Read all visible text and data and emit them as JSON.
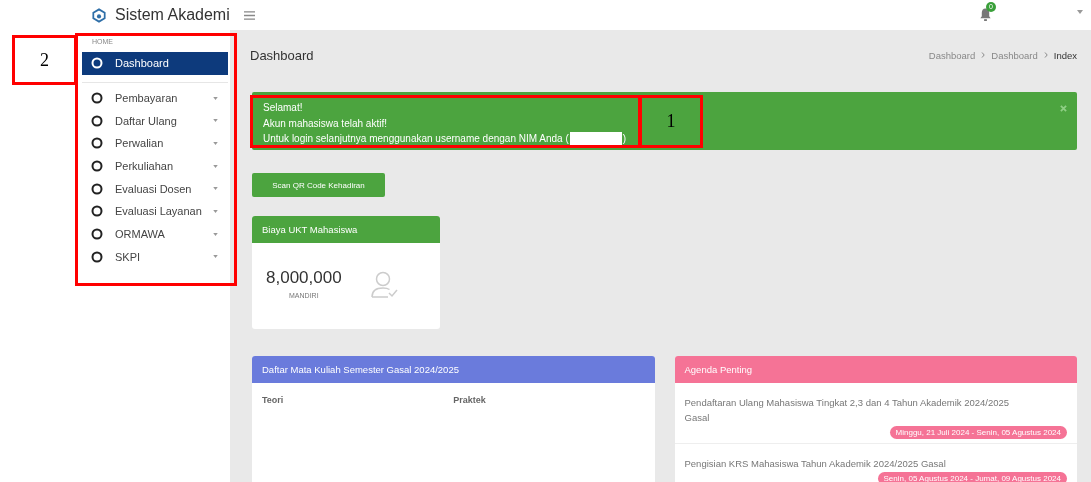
{
  "header": {
    "app_name": "Sistem Akademi",
    "notification_count": "0"
  },
  "sidebar": {
    "section": "HOME",
    "items": [
      {
        "label": "Dashboard",
        "selected": true,
        "has_submenu": false
      },
      {
        "label": "Pembayaran",
        "selected": false,
        "has_submenu": true
      },
      {
        "label": "Daftar Ulang",
        "selected": false,
        "has_submenu": true
      },
      {
        "label": "Perwalian",
        "selected": false,
        "has_submenu": true
      },
      {
        "label": "Perkuliahan",
        "selected": false,
        "has_submenu": true
      },
      {
        "label": "Evaluasi Dosen",
        "selected": false,
        "has_submenu": true
      },
      {
        "label": "Evaluasi Layanan",
        "selected": false,
        "has_submenu": true
      },
      {
        "label": "ORMAWA",
        "selected": false,
        "has_submenu": true
      },
      {
        "label": "SKPI",
        "selected": false,
        "has_submenu": true
      }
    ]
  },
  "page_title": "Dashboard",
  "breadcrumbs": [
    {
      "label": "Dashboard",
      "selected": false
    },
    {
      "label": "Dashboard",
      "selected": false
    },
    {
      "label": "Index",
      "selected": true
    }
  ],
  "alert": {
    "lines": [
      "Selamat!",
      "Akun mahasiswa telah aktif!",
      "Untuk login selanjutnya menggunakan username dengan NIM Anda ("
    ],
    "closing": ")",
    "nim_redacted": true
  },
  "scan_button": "Scan QR Code Kehadiran",
  "ukt_card": {
    "title": "Biaya UKT Mahasiswa",
    "amount": "8,000,000",
    "category": "MANDIRI"
  },
  "courses_card": {
    "title": "Daftar Mata Kuliah Semester Gasal 2024/2025",
    "columns": [
      "Teori",
      "Praktek"
    ]
  },
  "agenda_card": {
    "title": "Agenda Penting",
    "items": [
      {
        "title": "Pendaftaran Ulang Mahasiswa Tingkat 2,3 dan 4 Tahun Akademik 2024/2025 Gasal",
        "period": "Minggu, 21 Juli 2024 - Senin, 05 Agustus 2024"
      },
      {
        "title": "Pengisian KRS Mahasiswa Tahun Akademik 2024/2025 Gasal",
        "period": "Senin, 05 Agustus 2024 - Jumat, 09 Agustus 2024"
      }
    ]
  },
  "annotations": [
    {
      "kind": "label",
      "label": "2"
    },
    {
      "kind": "frame"
    },
    {
      "kind": "frame"
    },
    {
      "kind": "label",
      "label": "1"
    }
  ]
}
